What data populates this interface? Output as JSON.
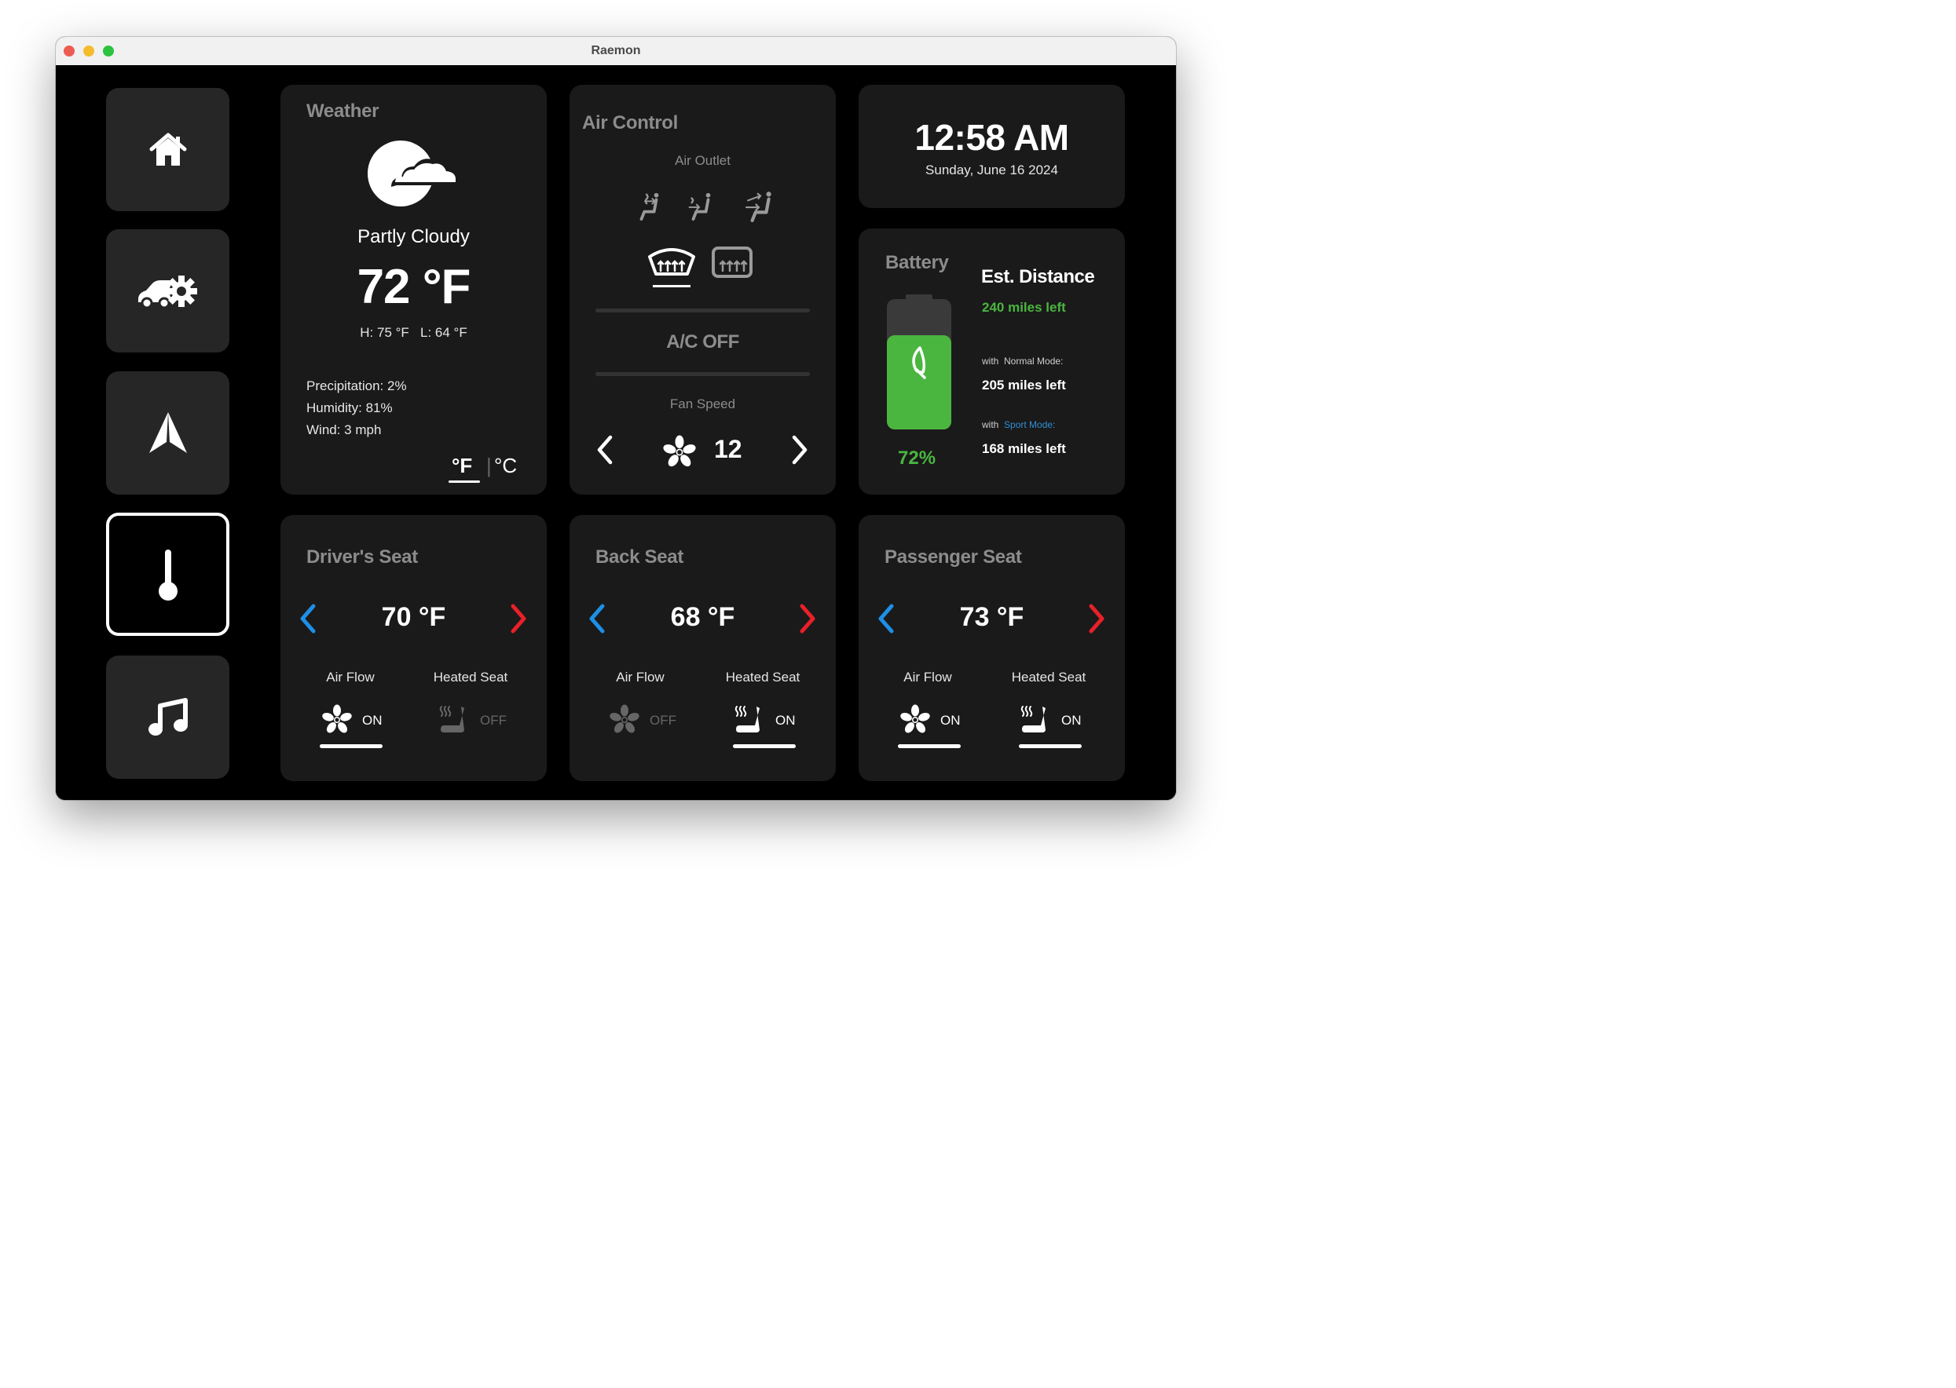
{
  "window": {
    "title": "Raemon"
  },
  "colors": {
    "accent_blue": "#1e8fe6",
    "accent_red": "#e8202a",
    "battery_green": "#4ab63f",
    "sport_blue": "#2f8fd6"
  },
  "sidebar": {
    "items": [
      {
        "icon": "home-icon"
      },
      {
        "icon": "car-settings-icon"
      },
      {
        "icon": "navigation-icon"
      },
      {
        "icon": "thermometer-icon",
        "active": true
      },
      {
        "icon": "music-icon"
      }
    ]
  },
  "weather": {
    "title": "Weather",
    "condition": "Partly Cloudy",
    "temperature": "72 °F",
    "high_low": "H: 75 °F   L: 64 °F",
    "precipitation": "Precipitation: 2%",
    "humidity": "Humidity: 81%",
    "wind": "Wind: 3 mph",
    "unit_f": "°F",
    "unit_separator": "|",
    "unit_c": "°C",
    "selected_unit": "°F"
  },
  "air_control": {
    "title": "Air Control",
    "air_outlet_label": "Air Outlet",
    "ac_status": "A/C OFF",
    "fan_speed_label": "Fan Speed",
    "fan_speed": "12"
  },
  "clock": {
    "time": "12:58 AM",
    "date": "Sunday, June 16 2024"
  },
  "battery": {
    "title": "Battery",
    "percent": "72%",
    "level": 0.72,
    "est_title": "Est. Distance",
    "miles_left": "240 miles left",
    "normal_prefix": "with",
    "normal_mode": "Normal Mode:",
    "normal_miles": "205 miles left",
    "sport_prefix": "with",
    "sport_mode": "Sport Mode:",
    "sport_miles": "168 miles left"
  },
  "seats": {
    "driver": {
      "title": "Driver's Seat",
      "temp": "70 °F",
      "air_flow_label": "Air Flow",
      "air_flow": "ON",
      "heated_label": "Heated Seat",
      "heated": "OFF"
    },
    "back": {
      "title": "Back Seat",
      "temp": "68 °F",
      "air_flow_label": "Air Flow",
      "air_flow": "OFF",
      "heated_label": "Heated Seat",
      "heated": "ON"
    },
    "passenger": {
      "title": "Passenger Seat",
      "temp": "73 °F",
      "air_flow_label": "Air Flow",
      "air_flow": "ON",
      "heated_label": "Heated Seat",
      "heated": "ON"
    }
  }
}
